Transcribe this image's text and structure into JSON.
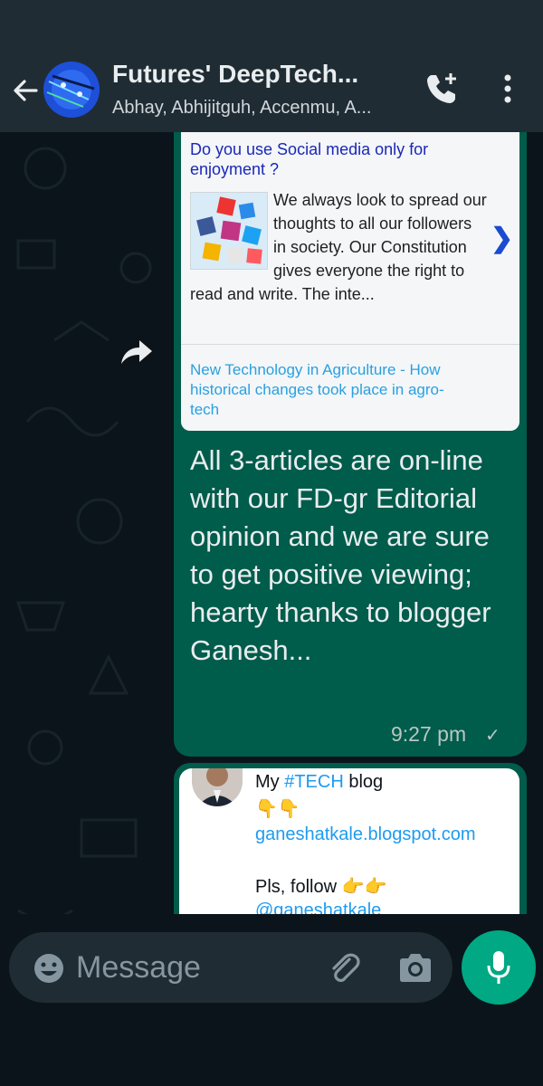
{
  "header": {
    "title": "Futures' DeepTech...",
    "subtitle": "Abhay, Abhijitguh, Accenmu, A...",
    "icons": [
      "back-arrow-icon",
      "group-avatar",
      "add-call-icon",
      "more-vertical-icon"
    ]
  },
  "messages": [
    {
      "preview": {
        "title": "Do you use Social media only for enjoyment ?",
        "description": "We always look to spread our thoughts to all our followers in society. Our Constitution gives everyone the right to read and write. The inte...",
        "next_icon": "❯",
        "link_text": "New Technology in Agriculture - How historical changes took place in agro-tech"
      },
      "text": "All 3-articles are on-line with our FD-gr Editorial opinion and we are sure to get positive viewing; hearty thanks to blogger Ganesh...",
      "time": "9:27 pm",
      "status_icon": "✓"
    },
    {
      "tweet": {
        "line1_prefix": "My ",
        "hashtag": "#TECH",
        "line1_suffix": " blog",
        "emoji_line": "👇👇",
        "blog_url": "ganeshatkale.blogspot.com",
        "follow_text": "Pls, follow ",
        "follow_emoji": "👉👉",
        "handle": "@ganeshatkale"
      }
    }
  ],
  "composer": {
    "placeholder": "Message",
    "icons": [
      "emoji-icon",
      "attach-icon",
      "camera-icon",
      "mic-icon"
    ]
  },
  "colors": {
    "header_bg": "#1f2c33",
    "chat_bg": "#0b141a",
    "outgoing_bubble": "#005c4b",
    "accent_green": "#00a884",
    "link_blue": "#2aa0e0",
    "title_blue": "#1a28b8"
  }
}
